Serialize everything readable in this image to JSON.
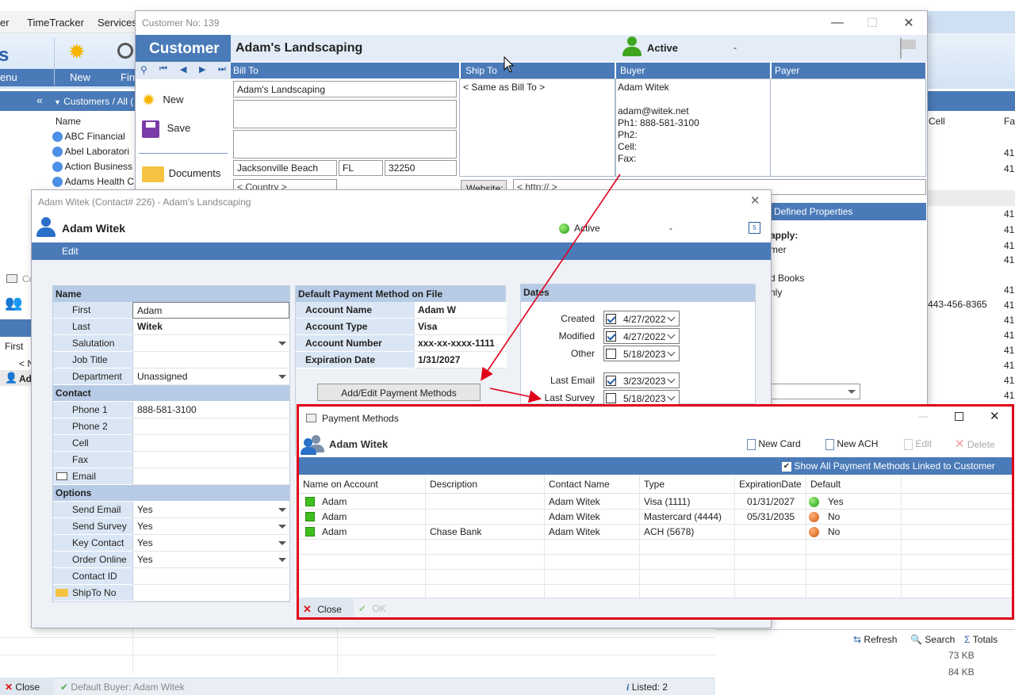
{
  "bg": {
    "menu": [
      "er",
      "TimeTracker",
      "Services"
    ],
    "ribbon_left": "enu",
    "ribbon_new": "New",
    "ribbon_find": "Find",
    "panel_title": "Customers / All (",
    "name_header": "Name",
    "customers": [
      "ABC Financial",
      "Abel Laboratori",
      "Action Business",
      "Adams Health C"
    ],
    "cell_header": "Cell",
    "fa_header": "Fa",
    "cell_value": "443-456-8365",
    "right_col_values": [
      "41",
      "41",
      "41",
      "41",
      "41",
      "41",
      "41",
      "41",
      "41",
      "41",
      "41",
      "41",
      "41",
      "41"
    ],
    "mini_title": "Co",
    "first_label": "First",
    "n_label": "< N",
    "ad_label": "Ad",
    "refresh": "Refresh",
    "search": "Search",
    "totals": "Totals",
    "sizes": [
      "73 KB",
      "84 KB"
    ],
    "close": "Close",
    "default_buyer": "Default Buyer: Adam Witek",
    "listed": "Listed: 2"
  },
  "customer_win": {
    "title": "Customer No: 139",
    "header_label": "Customer",
    "name": "Adam's Landscaping",
    "status": "Active",
    "dash": "-",
    "side_new": "New",
    "side_save": "Save",
    "side_documents": "Documents",
    "cols": [
      "Bill To",
      "Ship To",
      "Buyer",
      "Payer"
    ],
    "bill_name": "Adam's Landscaping",
    "city": "Jacksonville Beach",
    "state": "FL",
    "zip": "32250",
    "country": "< Country >",
    "ship_to": "< Same as Bill To >",
    "buyer_lines": [
      "Adam Witek",
      "",
      "adam@witek.net",
      "Ph1: 888-581-3100",
      "Ph2:",
      "Cell:",
      "Fax:"
    ],
    "website_btn": "Website:",
    "website": "< http:// >",
    "defined_props": "Defined Properties",
    "apply_text": [
      "apply:",
      "mer",
      "d Books",
      "nly"
    ]
  },
  "contact_win": {
    "title": "Adam Witek  (Contact# 226)  -  Adam's Landscaping",
    "name": "Adam Witek",
    "status": "Active",
    "dash": "-",
    "edit_tab": "Edit",
    "name_section": "Name",
    "fields_name": [
      {
        "label": "First",
        "value": "Adam",
        "dd": false
      },
      {
        "label": "Last",
        "value": "Witek",
        "dd": false
      },
      {
        "label": "Salutation",
        "value": "",
        "dd": true
      },
      {
        "label": "Job Title",
        "value": "",
        "dd": false
      },
      {
        "label": "Department",
        "value": "Unassigned",
        "dd": true
      }
    ],
    "contact_section": "Contact",
    "fields_contact": [
      {
        "label": "Phone 1",
        "value": "888-581-3100",
        "dd": false
      },
      {
        "label": "Phone 2",
        "value": "",
        "dd": false
      },
      {
        "label": "Cell",
        "value": "",
        "dd": false
      },
      {
        "label": "Fax",
        "value": "",
        "dd": false
      },
      {
        "label": "Email",
        "value": "",
        "dd": false
      }
    ],
    "options_section": "Options",
    "fields_options": [
      {
        "label": "Send Email",
        "value": "Yes",
        "dd": true
      },
      {
        "label": "Send Survey",
        "value": "Yes",
        "dd": true
      },
      {
        "label": "Key Contact",
        "value": "Yes",
        "dd": true
      },
      {
        "label": "Order Online",
        "value": "Yes",
        "dd": true
      },
      {
        "label": "Contact ID",
        "value": "",
        "dd": false
      },
      {
        "label": "ShipTo No",
        "value": "",
        "dd": false
      }
    ],
    "payment_section": "Default Payment Method on File",
    "payment": [
      {
        "label": "Account Name",
        "value": "Adam W"
      },
      {
        "label": "Account Type",
        "value": "Visa"
      },
      {
        "label": "Account Number",
        "value": "xxx-xx-xxxx-1111"
      },
      {
        "label": "Expiration Date",
        "value": "1/31/2027"
      }
    ],
    "add_edit_btn": "Add/Edit Payment Methods",
    "dates_section": "Dates",
    "dates": [
      {
        "label": "Created",
        "value": "4/27/2022",
        "checked": true
      },
      {
        "label": "Modified",
        "value": "4/27/2022",
        "checked": true
      },
      {
        "label": "Other",
        "value": "5/18/2023",
        "checked": false
      },
      {
        "label": "Last Email",
        "value": "3/23/2023",
        "checked": true
      },
      {
        "label": "Last Survey",
        "value": "5/18/2023",
        "checked": false
      }
    ]
  },
  "pm_win": {
    "title": "Payment Methods",
    "name": "Adam Witek",
    "new_card": "New Card",
    "new_ach": "New ACH",
    "edit": "Edit",
    "delete": "Delete",
    "show_all": "Show All Payment Methods Linked to Customer",
    "columns": [
      "Name on Account",
      "Description",
      "Contact Name",
      "Type",
      "ExpirationDate",
      "Default"
    ],
    "rows": [
      {
        "name": "Adam",
        "description": "",
        "contact": "Adam Witek",
        "type": "Visa (1111)",
        "exp": "01/31/2027",
        "default": "Yes",
        "is_default": true
      },
      {
        "name": "Adam",
        "description": "",
        "contact": "Adam Witek",
        "type": "Mastercard (4444)",
        "exp": "05/31/2035",
        "default": "No",
        "is_default": false
      },
      {
        "name": "Adam",
        "description": "Chase Bank",
        "contact": "Adam Witek",
        "type": "ACH (5678)",
        "exp": "",
        "default": "No",
        "is_default": false
      }
    ],
    "close": "Close",
    "ok": "OK"
  },
  "colors": {
    "accent": "#4a7ab8",
    "highlight": "#e0001a",
    "sub_header": "#b7cbe6"
  }
}
